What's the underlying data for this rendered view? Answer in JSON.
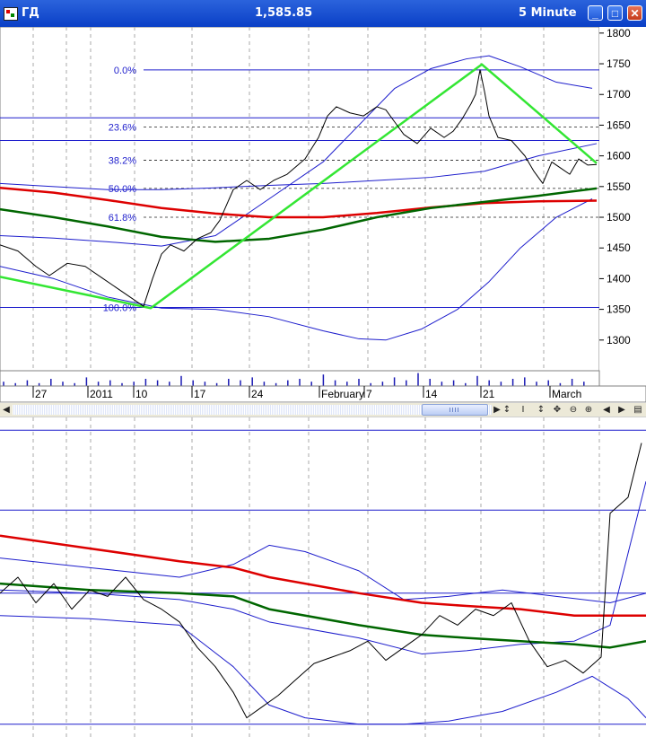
{
  "window": {
    "symbol": "ГД",
    "last_price": "1,585.85",
    "interval": "5 Minute",
    "buttons": {
      "minimize": "_",
      "maximize": "□",
      "close": "✕"
    }
  },
  "toolbar": {
    "left_arrow": "◀",
    "right_arrow": "▶",
    "tools": [
      "↕",
      "I",
      "↕",
      "✥",
      "⊖",
      "⊕",
      "◀",
      "▶",
      "▤"
    ]
  },
  "colors": {
    "price": "#000000",
    "bands": "#1d1dcc",
    "fib": "#1d1dcc",
    "zigzag": "#33e633",
    "ma_long": "#dd0000",
    "ma_medium": "#006600",
    "volume": "#1a1ab4"
  },
  "chart_data": [
    {
      "type": "line",
      "panel": "price",
      "y_ticks": [
        1300,
        1350,
        1400,
        1450,
        1500,
        1550,
        1600,
        1650,
        1700,
        1750,
        1800
      ],
      "ylim": [
        1250,
        1810
      ],
      "x_labels": [
        "27",
        "2011",
        "10",
        "17",
        "24",
        "February",
        "7",
        "14",
        "21",
        "March"
      ],
      "fib_levels": [
        {
          "label": "0.0%",
          "value": 1740
        },
        {
          "label": "23.6%",
          "value": 1647
        },
        {
          "label": "38.2%",
          "value": 1593
        },
        {
          "label": "50.0%",
          "value": 1547
        },
        {
          "label": "61.8%",
          "value": 1500
        },
        {
          "label": "100.0%",
          "value": 1353
        }
      ],
      "horizontal_lines": [
        1740,
        1662,
        1625,
        1353
      ],
      "price": {
        "x": [
          0,
          20,
          40,
          55,
          75,
          95,
          115,
          130,
          145,
          160,
          170,
          180,
          190,
          205,
          220,
          235,
          245,
          260,
          275,
          290,
          305,
          320,
          340,
          355,
          365,
          375,
          390,
          405,
          420,
          430,
          440,
          450,
          465,
          480,
          495,
          505,
          515,
          525,
          530,
          535,
          540,
          545,
          555,
          570,
          585,
          595,
          605,
          615,
          625,
          635,
          645,
          655,
          665
        ],
        "y": [
          1455,
          1445,
          1420,
          1405,
          1425,
          1420,
          1400,
          1385,
          1370,
          1355,
          1400,
          1440,
          1455,
          1445,
          1465,
          1475,
          1495,
          1545,
          1560,
          1545,
          1560,
          1570,
          1595,
          1630,
          1665,
          1680,
          1670,
          1665,
          1680,
          1675,
          1655,
          1635,
          1620,
          1645,
          1630,
          1640,
          1660,
          1685,
          1700,
          1740,
          1705,
          1665,
          1630,
          1625,
          1600,
          1575,
          1555,
          1590,
          1580,
          1570,
          1595,
          1585,
          1586
        ]
      },
      "zigzag": {
        "x": [
          0,
          168,
          537,
          665
        ],
        "y": [
          1403,
          1352,
          1749,
          1588
        ]
      },
      "ma_long": {
        "x": [
          0,
          60,
          120,
          180,
          240,
          300,
          360,
          420,
          480,
          540,
          600,
          665
        ],
        "y": [
          1548,
          1540,
          1528,
          1515,
          1506,
          1500,
          1500,
          1507,
          1516,
          1523,
          1526,
          1527
        ]
      },
      "ma_medium": {
        "x": [
          0,
          60,
          120,
          180,
          240,
          300,
          360,
          420,
          480,
          540,
          600,
          665
        ],
        "y": [
          1513,
          1500,
          1485,
          1468,
          1460,
          1465,
          1480,
          1500,
          1515,
          1525,
          1535,
          1547
        ]
      },
      "band_upper": {
        "x": [
          0,
          60,
          120,
          180,
          240,
          300,
          360,
          400,
          440,
          480,
          520,
          545,
          580,
          620,
          660
        ],
        "y": [
          1470,
          1466,
          1460,
          1453,
          1470,
          1530,
          1590,
          1650,
          1710,
          1742,
          1758,
          1763,
          1745,
          1720,
          1710
        ]
      },
      "band_mid": {
        "x": [
          0,
          60,
          120,
          180,
          240,
          300,
          360,
          420,
          480,
          540,
          600,
          665
        ],
        "y": [
          1555,
          1550,
          1545,
          1545,
          1548,
          1552,
          1555,
          1560,
          1565,
          1575,
          1600,
          1620
        ]
      },
      "band_lower": {
        "x": [
          0,
          60,
          120,
          180,
          240,
          300,
          360,
          400,
          430,
          470,
          510,
          545,
          580,
          620,
          660
        ],
        "y": [
          1420,
          1400,
          1370,
          1352,
          1350,
          1338,
          1315,
          1302,
          1300,
          1318,
          1350,
          1395,
          1450,
          1500,
          1530
        ]
      },
      "volume": [
        3,
        2,
        4,
        2,
        5,
        3,
        2,
        6,
        3,
        4,
        2,
        3,
        5,
        4,
        3,
        7,
        4,
        3,
        2,
        5,
        4,
        6,
        3,
        2,
        4,
        5,
        3,
        8,
        4,
        3,
        5,
        2,
        3,
        6,
        4,
        9,
        5,
        3,
        4,
        2,
        7,
        4,
        3,
        5,
        6,
        3,
        4,
        2,
        5,
        3
      ]
    },
    {
      "type": "line",
      "panel": "oscillator",
      "ylim": [
        0,
        100
      ],
      "horizontal_lines": [
        96,
        71,
        45,
        4
      ],
      "osc": {
        "x": [
          0,
          20,
          40,
          60,
          80,
          100,
          120,
          140,
          160,
          180,
          200,
          220,
          240,
          260,
          275,
          290,
          310,
          330,
          350,
          370,
          390,
          410,
          430,
          450,
          470,
          490,
          510,
          530,
          550,
          570,
          590,
          610,
          630,
          650,
          670,
          680,
          700,
          715
        ],
        "y": [
          45,
          50,
          42,
          48,
          40,
          46,
          44,
          50,
          43,
          40,
          36,
          28,
          22,
          14,
          6,
          9,
          13,
          18,
          23,
          25,
          27,
          30,
          24,
          28,
          32,
          38,
          35,
          40,
          38,
          42,
          30,
          22,
          24,
          20,
          25,
          70,
          75,
          92
        ]
      },
      "osc_ma_red": {
        "x": [
          0,
          100,
          200,
          260,
          300,
          400,
          470,
          520,
          580,
          640,
          680,
          720
        ],
        "y": [
          63,
          59,
          55,
          53,
          50,
          45,
          42,
          41,
          40,
          38,
          38,
          38
        ]
      },
      "osc_ma_green": {
        "x": [
          0,
          100,
          200,
          260,
          300,
          400,
          470,
          520,
          580,
          640,
          680,
          720
        ],
        "y": [
          48,
          46,
          45,
          44,
          40,
          35,
          32,
          31,
          30,
          29,
          28,
          30
        ]
      },
      "osc_band_upper": {
        "x": [
          0,
          100,
          200,
          260,
          300,
          340,
          400,
          450,
          500,
          560,
          620,
          680,
          720
        ],
        "y": [
          56,
          53,
          50,
          54,
          60,
          58,
          52,
          43,
          44,
          46,
          44,
          42,
          45
        ]
      },
      "osc_band_mid": {
        "x": [
          0,
          100,
          200,
          260,
          300,
          400,
          470,
          520,
          580,
          640,
          680,
          720
        ],
        "y": [
          46,
          45,
          43,
          40,
          36,
          31,
          26,
          27,
          29,
          30,
          35,
          80
        ]
      },
      "osc_band_lower": {
        "x": [
          0,
          100,
          200,
          260,
          300,
          340,
          400,
          450,
          500,
          560,
          620,
          660,
          700,
          720
        ],
        "y": [
          38,
          37,
          35,
          22,
          10,
          6,
          4,
          4,
          5,
          8,
          14,
          19,
          12,
          6
        ]
      }
    }
  ]
}
